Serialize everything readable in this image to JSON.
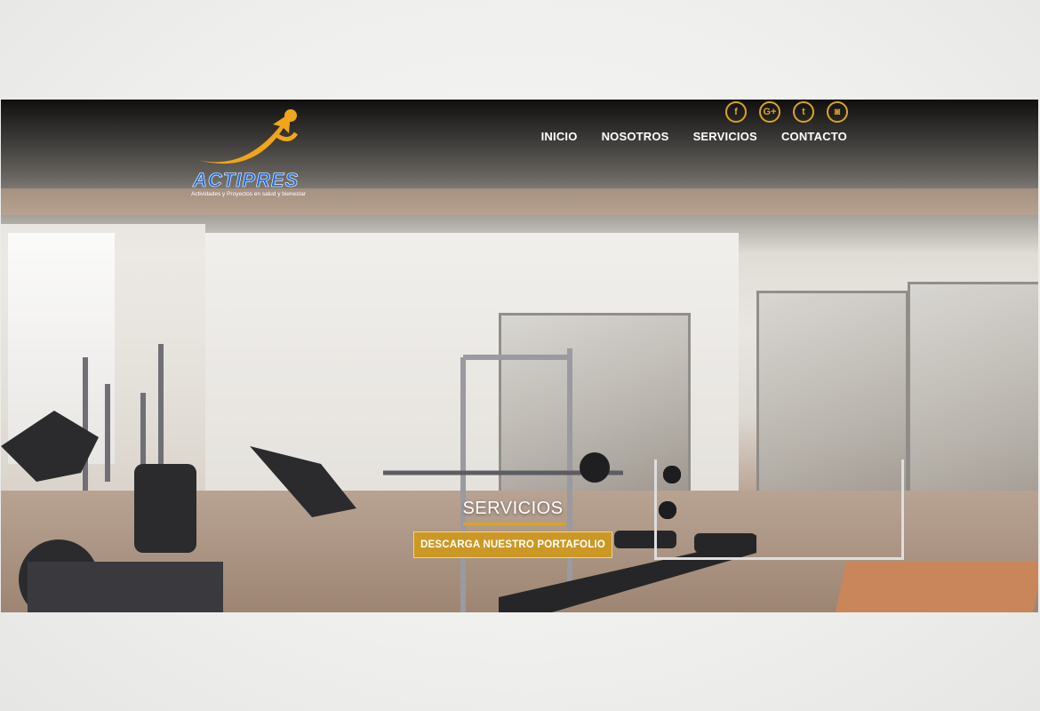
{
  "brand": {
    "name": "ACTIPRES",
    "tagline": "Actividades y Proyectos en salud y bienestar",
    "logo_colors": {
      "swoosh": "#f0a51b",
      "text": "#2e6fd0"
    }
  },
  "socials": [
    {
      "icon": "facebook-icon",
      "glyph": "f"
    },
    {
      "icon": "google-plus-icon",
      "glyph": "G+"
    },
    {
      "icon": "twitter-icon",
      "glyph": "t"
    },
    {
      "icon": "instagram-icon",
      "glyph": "◙"
    }
  ],
  "nav": {
    "items": [
      "INICIO",
      "NOSOTROS",
      "SERVICIOS",
      "CONTACTO"
    ]
  },
  "hero": {
    "title": "SERVICIOS",
    "cta_label": "DESCARGA NUESTRO PORTAFOLIO"
  },
  "colors": {
    "accent": "#d9a51f",
    "nav_text": "#ffffff"
  }
}
